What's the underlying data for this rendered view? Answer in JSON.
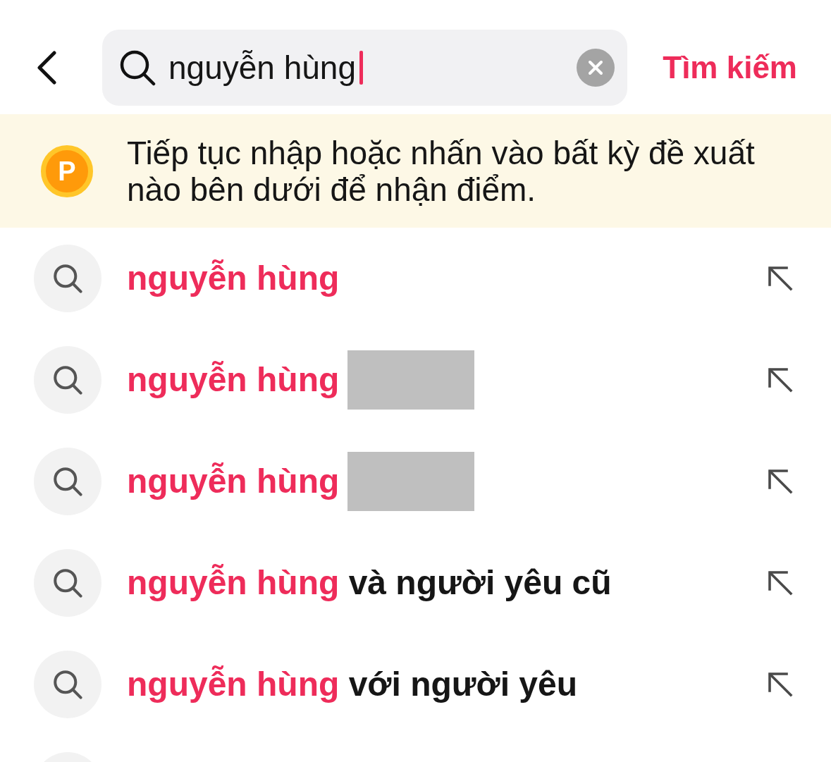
{
  "search_bar": {
    "value": "nguyễn hùng",
    "focused": true,
    "submit_label": "Tìm kiếm"
  },
  "points_banner": {
    "coin_label": "P",
    "text": "Tiếp tục nhập hoặc nhấn vào bất kỳ đề xuất nào bên dưới để nhận điểm."
  },
  "suggestions": [
    {
      "match": "nguyễn hùng",
      "redacted": false
    },
    {
      "match": "nguyễn hùng",
      "redacted": true
    },
    {
      "match": "nguyễn hùng",
      "redacted": true
    },
    {
      "match": "nguyễn hùng",
      "rest": "và người yêu cũ",
      "redacted": false
    },
    {
      "match": "nguyễn hùng",
      "rest": "với người yêu",
      "redacted": false
    }
  ],
  "partial_row_below": true
}
